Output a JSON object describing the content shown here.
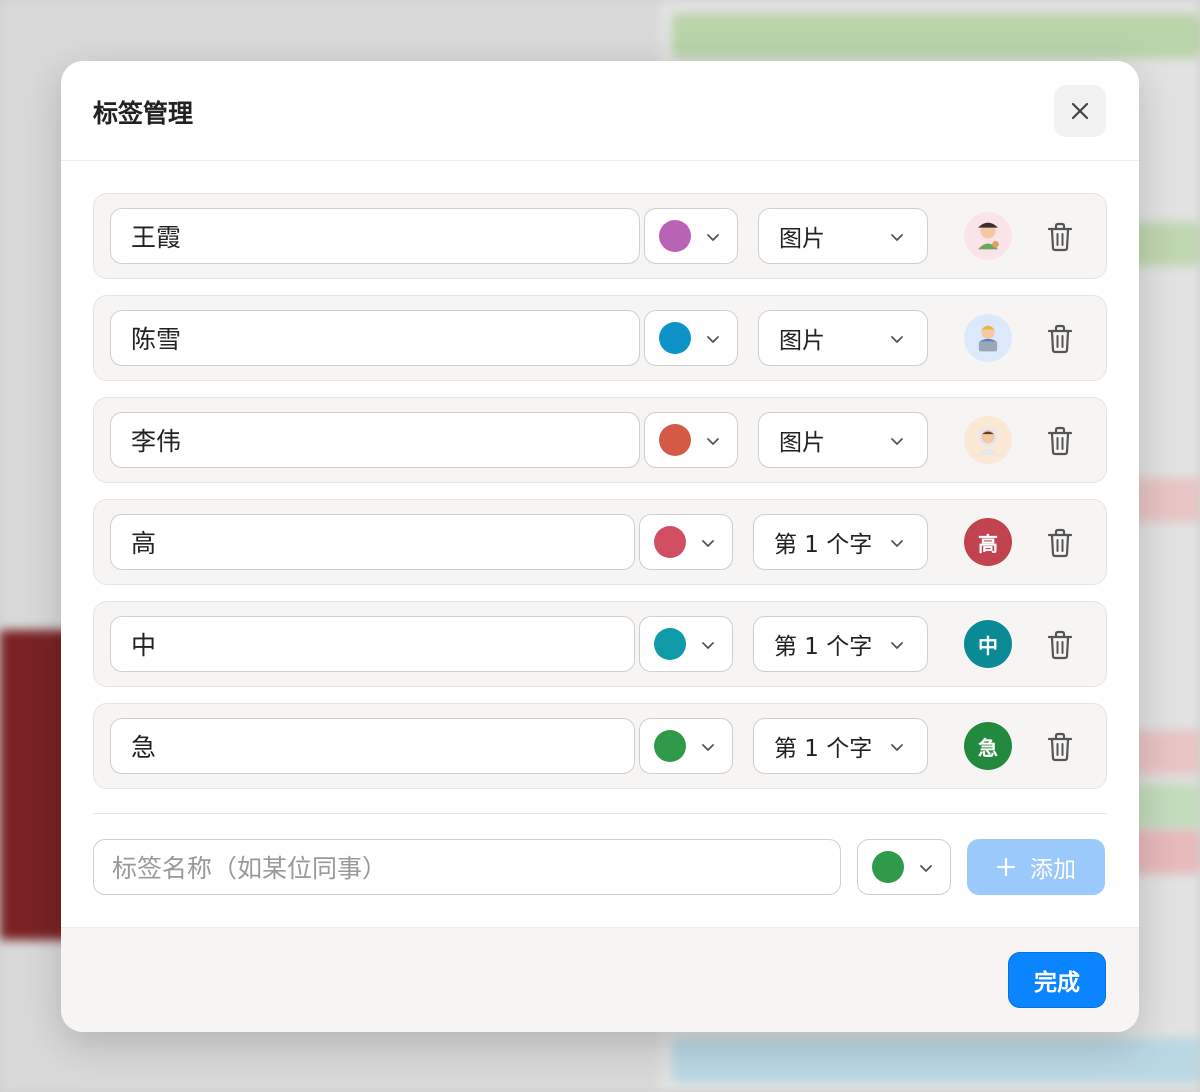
{
  "background": {
    "color_note": "#d9d9d9"
  },
  "modal": {
    "title": "标签管理",
    "tags": [
      {
        "name": "王霞",
        "color": "#b963b5",
        "mode": "图片",
        "avatar_kind": "emoji",
        "avatar_icon": "artist-emoji",
        "avatar_bg": "#fbe3ea"
      },
      {
        "name": "陈雪",
        "color": "#0e93c8",
        "mode": "图片",
        "avatar_kind": "emoji",
        "avatar_icon": "technologist-emoji",
        "avatar_bg": "#dce9fb"
      },
      {
        "name": "李伟",
        "color": "#d45a45",
        "mode": "图片",
        "avatar_kind": "emoji",
        "avatar_icon": "astronaut-emoji",
        "avatar_bg": "#fbe9d6"
      },
      {
        "name": "高",
        "color": "#d24e62",
        "mode": "第 1 个字",
        "avatar_kind": "text",
        "avatar_text": "高",
        "avatar_bg": "#c0434f"
      },
      {
        "name": "中",
        "color": "#0e9aa7",
        "mode": "第 1 个字",
        "avatar_kind": "text",
        "avatar_text": "中",
        "avatar_bg": "#0a8a95"
      },
      {
        "name": "急",
        "color": "#2e9a4a",
        "mode": "第 1 个字",
        "avatar_kind": "text",
        "avatar_text": "急",
        "avatar_bg": "#23893e"
      }
    ],
    "new_tag": {
      "placeholder": "标签名称（如某位同事）",
      "color": "#2e9a4a",
      "add_label": "添加"
    },
    "done_label": "完成"
  }
}
